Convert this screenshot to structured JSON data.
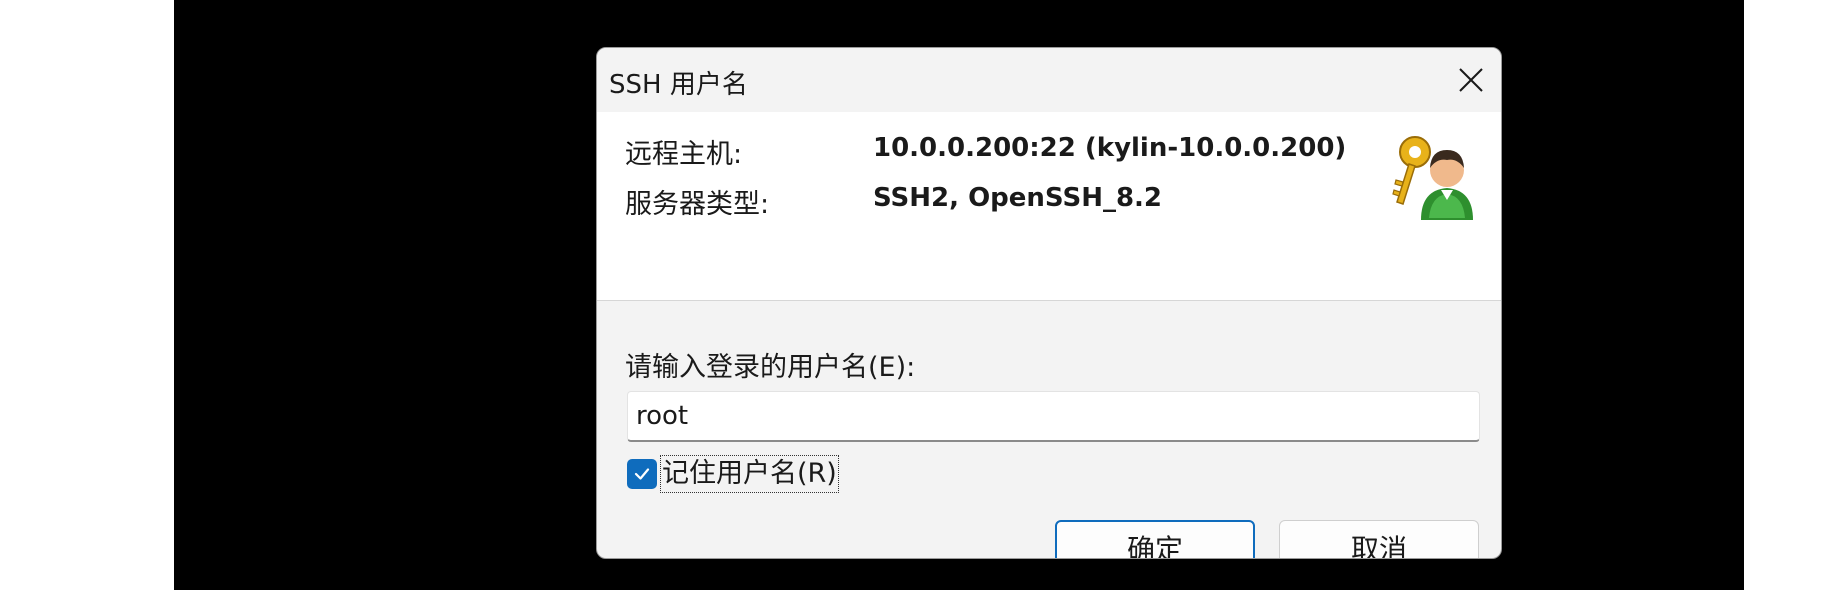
{
  "dialog": {
    "title": "SSH 用户名",
    "close_icon": "close-icon"
  },
  "info": {
    "host_label": "远程主机:",
    "host_value": "10.0.0.200:22 (kylin-10.0.0.200)",
    "server_type_label": "服务器类型:",
    "server_type_value": "SSH2, OpenSSH_8.2",
    "icon": "key-user-icon"
  },
  "form": {
    "prompt_label": "请输入登录的用户名(E):",
    "username_value": "root",
    "remember_checked": true,
    "remember_label": "记住用户名(R)"
  },
  "buttons": {
    "ok_label": "确定",
    "cancel_label": "取消"
  },
  "colors": {
    "accent": "#0f6cbd",
    "backdrop": "#000000",
    "dialog_bg": "#f3f3f3",
    "panel_bg": "#ffffff"
  }
}
